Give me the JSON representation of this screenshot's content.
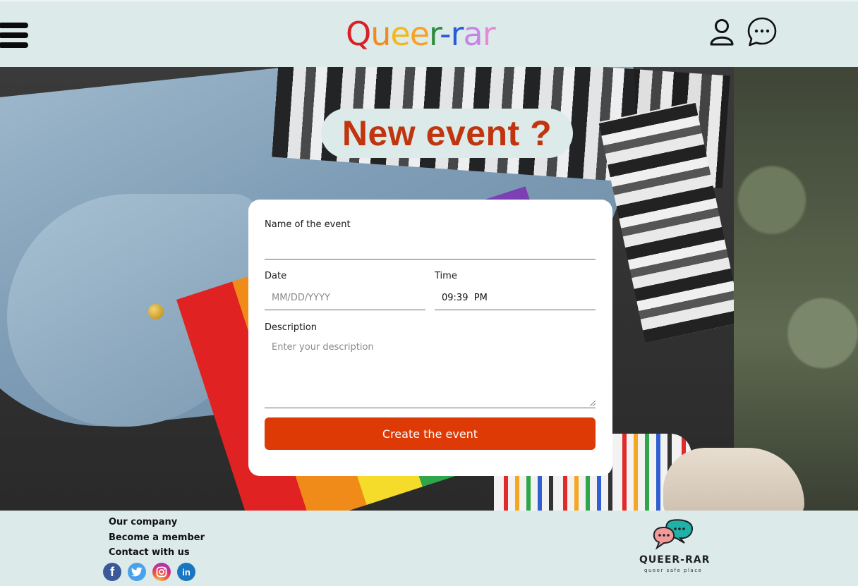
{
  "header": {
    "logo_letters": [
      {
        "ch": "Q",
        "color": "#d82027"
      },
      {
        "ch": "u",
        "color": "#f08a1a"
      },
      {
        "ch": "e",
        "color": "#f2b81c"
      },
      {
        "ch": "e",
        "color": "#f6a12a"
      },
      {
        "ch": "r",
        "color": "#2e8b3e"
      },
      {
        "ch": "-",
        "color": "#2a5bd7"
      },
      {
        "ch": "r",
        "color": "#2a5bd7"
      },
      {
        "ch": "a",
        "color": "#c784e6"
      },
      {
        "ch": "r",
        "color": "#e58ad7"
      }
    ],
    "menu_icon": "hamburger-icon",
    "user_icon": "user-icon",
    "chat_icon": "chat-icon"
  },
  "hero": {
    "title": "New event ?"
  },
  "form": {
    "name_label": "Name of the event",
    "name_value": "",
    "date_label": "Date",
    "date_placeholder": "MM/DD/YYYY",
    "time_label": "Time",
    "time_value": "09:39  PM",
    "description_label": "Description",
    "description_placeholder": "Enter your description",
    "submit_label": "Create the event",
    "accent_color": "#dd3a06"
  },
  "footer": {
    "links": [
      "Our company",
      "Become a member",
      "Contact with us"
    ],
    "social": [
      "facebook-icon",
      "twitter-icon",
      "instagram-icon",
      "linkedin-icon"
    ],
    "brand": "QUEER-RAR",
    "tagline": "queer safe place"
  }
}
